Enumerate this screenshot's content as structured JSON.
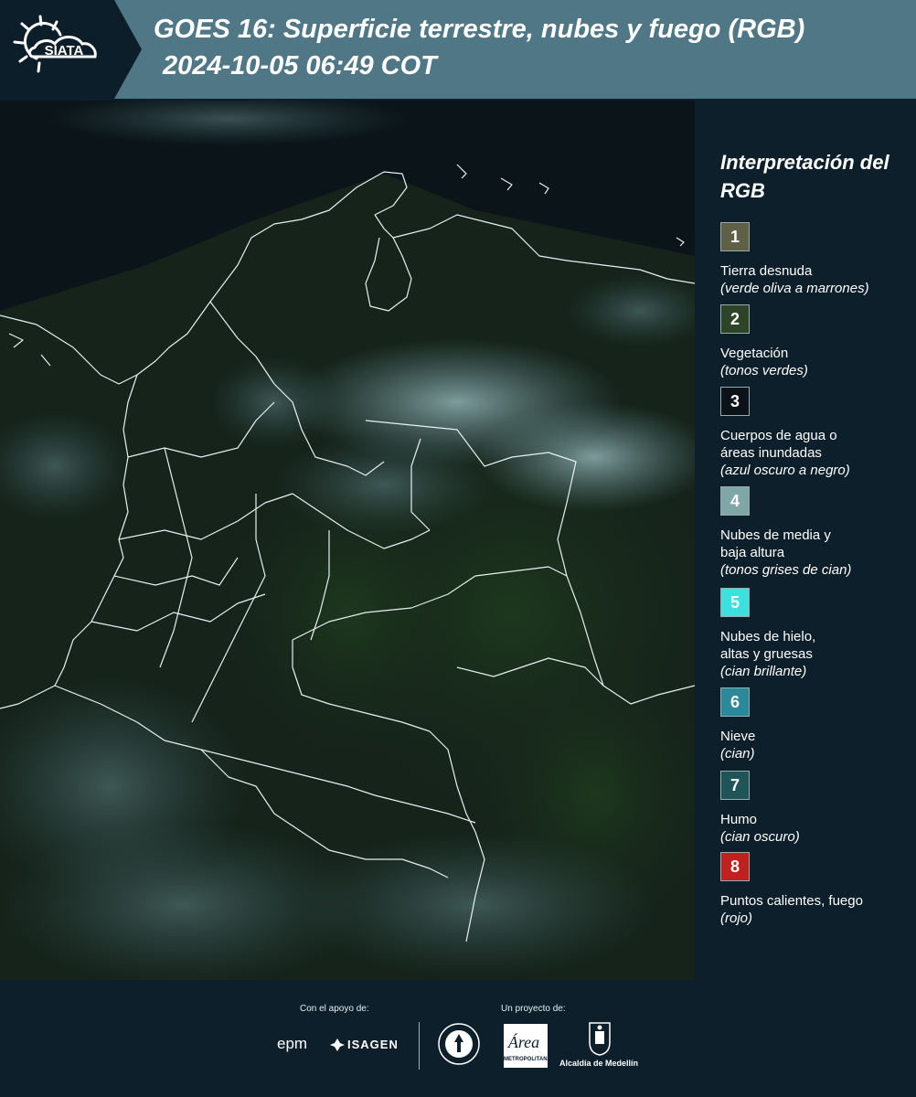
{
  "header": {
    "logo_text": "SIATA",
    "title_line1": "GOES 16: Superficie terrestre, nubes y fuego (RGB)",
    "title_line2": "2024-10-05 06:49 COT"
  },
  "legend": {
    "title": "Interpretación del RGB",
    "items": [
      {
        "number": "1",
        "label": "Tierra desnuda",
        "desc": "(verde oliva a marrones)",
        "color": "#5f6046"
      },
      {
        "number": "2",
        "label": "Vegetación",
        "desc": "(tonos verdes)",
        "color": "#2e4426"
      },
      {
        "number": "3",
        "label": "Cuerpos de agua o áreas inundadas",
        "desc": "(azul oscuro a negro)",
        "color": "#0b1319"
      },
      {
        "number": "4",
        "label": "Nubes de media y baja altura",
        "desc": "(tonos grises de cian)",
        "color": "#7fa7a7"
      },
      {
        "number": "5",
        "label": "Nubes de hielo, altas y gruesas",
        "desc": "(cian brillante)",
        "color": "#3ce0dd"
      },
      {
        "number": "6",
        "label": "Nieve",
        "desc": "(cian)",
        "color": "#2a8a9a"
      },
      {
        "number": "7",
        "label": "Humo",
        "desc": "(cian oscuro)",
        "color": "#1f5556"
      },
      {
        "number": "8",
        "label": "Puntos calientes, fuego",
        "desc": "(rojo)",
        "color": "#c0201e"
      }
    ]
  },
  "footer": {
    "support_label": "Con el apoyo de:",
    "project_label": "Un proyecto de:",
    "sponsors": [
      "epm",
      "ISAGEN"
    ],
    "partners": [
      "METROPOLITANA",
      "Alcaldía de Medellín"
    ]
  }
}
